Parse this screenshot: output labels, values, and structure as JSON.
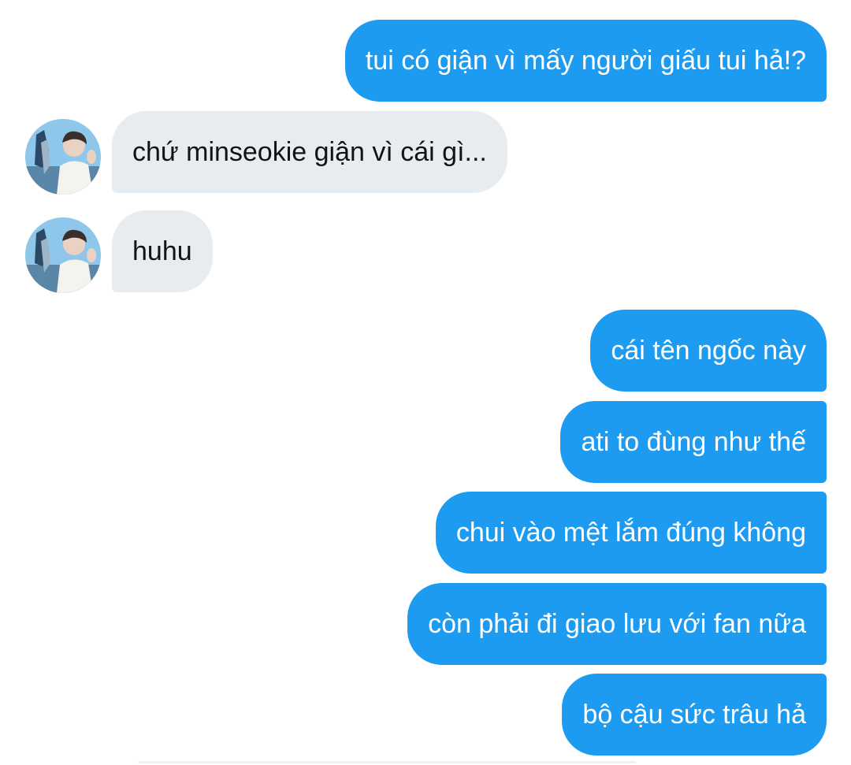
{
  "conversation": {
    "messages": [
      {
        "side": "outgoing",
        "text": "tui có giận vì mấy người giấu tui hả!?"
      },
      {
        "side": "incoming",
        "text": "chứ minseokie giận vì cái gì..."
      },
      {
        "side": "incoming",
        "text": "huhu"
      },
      {
        "side": "outgoing",
        "text": "cái tên ngốc này"
      },
      {
        "side": "outgoing",
        "text": "ati to đùng như thế"
      },
      {
        "side": "outgoing",
        "text": "chui vào mệt lắm đúng không"
      },
      {
        "side": "outgoing",
        "text": "còn phải đi giao lưu với fan nữa"
      },
      {
        "side": "outgoing",
        "text": "bộ cậu sức trâu hả"
      }
    ]
  },
  "colors": {
    "outgoing_bubble": "#1d9bf0",
    "incoming_bubble": "#e7ecf0",
    "outgoing_text": "#ffffff",
    "incoming_text": "#0f1419"
  },
  "icons": {
    "avatar": "profile-photo-avatar-icon"
  }
}
